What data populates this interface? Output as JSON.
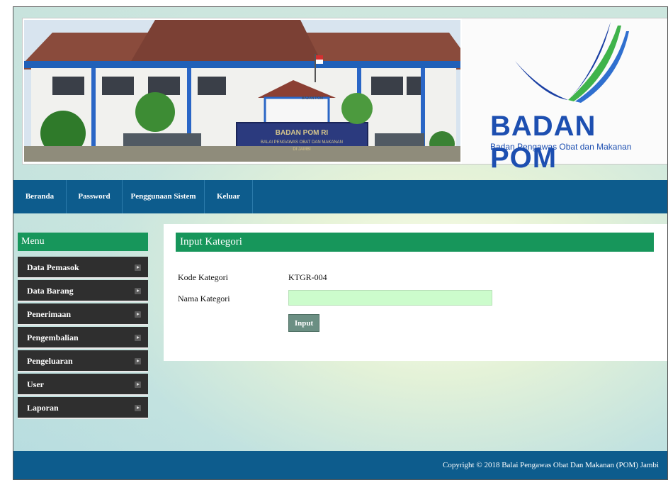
{
  "header": {
    "logo_title_part1": "BADAN",
    "logo_title_part2": "POM",
    "logo_subtitle": "Badan Pengawas Obat dan Makanan",
    "building_sign_line1": "BADAN POM",
    "building_sign_line2": "BADAN POM RI",
    "building_sign_line3": "BALAI PENGAWAS OBAT DAN MAKANAN",
    "building_sign_line4": "DI JAMBI"
  },
  "nav": {
    "items": [
      {
        "label": "Beranda"
      },
      {
        "label": "Password"
      },
      {
        "label": "Penggunaan Sistem"
      },
      {
        "label": "Keluar"
      }
    ]
  },
  "sidebar": {
    "title": "Menu",
    "items": [
      {
        "label": "Data Pemasok"
      },
      {
        "label": "Data Barang"
      },
      {
        "label": "Penerimaan"
      },
      {
        "label": "Pengembalian"
      },
      {
        "label": "Pengeluaran"
      },
      {
        "label": "User"
      },
      {
        "label": "Laporan"
      }
    ]
  },
  "form": {
    "title": "Input Kategori",
    "code_label": "Kode Kategori",
    "code_value": "KTGR-004",
    "name_label": "Nama Kategori",
    "name_value": "",
    "submit_label": "Input"
  },
  "footer": {
    "copyright": "Copyright © 2018 Balai Pengawas Obat Dan Makanan (POM) Jambi"
  },
  "colors": {
    "nav_bg": "#0d5c8d",
    "accent_green": "#17965b",
    "menu_bg": "#2f2f2f",
    "input_bg": "#ccfccc",
    "logo_blue": "#1d4fb1"
  }
}
